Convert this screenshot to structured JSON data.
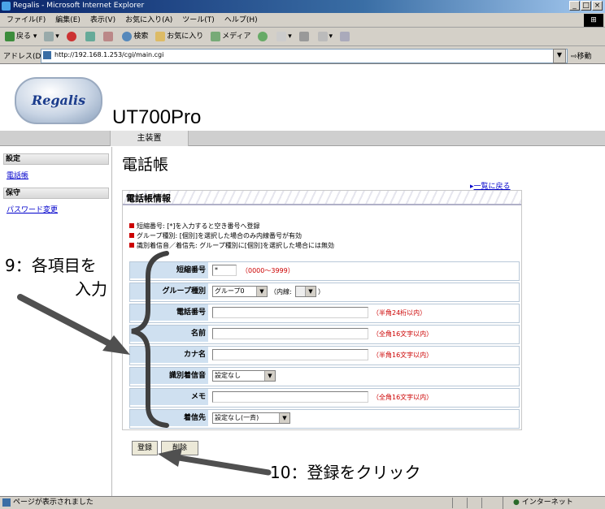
{
  "window": {
    "title": "Regalis - Microsoft Internet Explorer",
    "controls": [
      "_",
      "□",
      "×"
    ]
  },
  "menu": [
    "ファイル(F)",
    "編集(E)",
    "表示(V)",
    "お気に入り(A)",
    "ツール(T)",
    "ヘルプ(H)"
  ],
  "toolbar": {
    "back": "戻る",
    "search": "検索",
    "favorites": "お気に入り",
    "media": "メディア"
  },
  "address": {
    "label": "アドレス(D)",
    "url": "http://192.168.1.253/cgi/main.cgi",
    "go": "移動"
  },
  "header": {
    "logo": "Regalis",
    "product": "UT700Pro",
    "nav_tab": "主装置"
  },
  "sidebar": {
    "settings_heading": "設定",
    "phonebook_link": "電話帳",
    "maintenance_heading": "保守",
    "password_link": "パスワード変更"
  },
  "page": {
    "title": "電話帳",
    "back_link": "一覧に戻る",
    "panel_title": "電話帳情報",
    "notes": [
      "短縮番号: [*]を入力すると空き番号へ登録",
      "グループ種別: [個別]を選択した場合のみ内線番号が有効",
      "識別着信音／着信先: グループ種別に[個別]を選択した場合には無効"
    ]
  },
  "form": {
    "short_number": {
      "label": "短縮番号",
      "value": "*",
      "hint": "（0000～3999）"
    },
    "group_type": {
      "label": "グループ種別",
      "value": "グループ0",
      "ext_prefix": "（内線:",
      "ext_value": "",
      "ext_suffix": "）"
    },
    "phone_number": {
      "label": "電話番号",
      "value": "",
      "hint": "（半角24桁以内）"
    },
    "name": {
      "label": "名前",
      "value": "",
      "hint": "（全角16文字以内）"
    },
    "kana": {
      "label": "カナ名",
      "value": "",
      "hint": "（半角16文字以内）"
    },
    "ringtone": {
      "label": "識別着信音",
      "value": "設定なし"
    },
    "memo": {
      "label": "メモ",
      "value": "",
      "hint": "（全角16文字以内）"
    },
    "destination": {
      "label": "着信先",
      "value": "設定なし(一斉)"
    }
  },
  "buttons": {
    "register": "登録",
    "delete": "削除"
  },
  "status": {
    "left": "ページが表示されました",
    "zone": "インターネット"
  },
  "annotations": {
    "step9_line1": "9：各項目を",
    "step9_line2": "入力",
    "step10": "10：登録をクリック"
  }
}
